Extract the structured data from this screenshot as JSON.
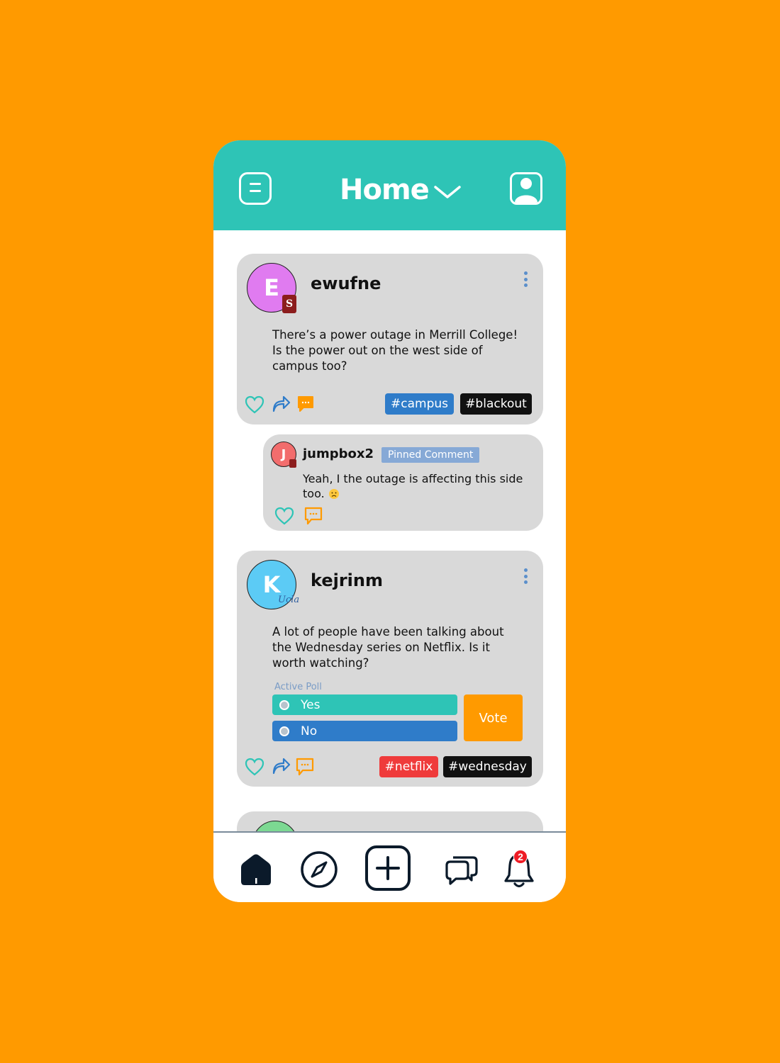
{
  "header": {
    "title": "Home",
    "menu_icon": "menu-icon",
    "profile_icon": "profile-icon",
    "chevron_icon": "chevron-down-icon"
  },
  "posts": [
    {
      "avatar_letter": "E",
      "avatar_color": "#E07BF0",
      "school_badge": "S",
      "username": "ewufne",
      "text_lines": [
        "There’s a power outage in Merrill College!",
        "Is the power out on the west side of",
        "campus too?"
      ],
      "tags": [
        "#campus",
        "#blackout"
      ]
    },
    {
      "avatar_letter": "K",
      "avatar_color": "#5CCBF5",
      "school_badge": "Ucla",
      "username": "kejrinm",
      "text_lines": [
        "A lot of people have been talking about",
        "the Wednesday series on Netflix. Is it",
        "worth watching?"
      ],
      "poll": {
        "label": "Active Poll",
        "options": [
          "Yes",
          "No"
        ],
        "vote_label": "Vote"
      },
      "tags": [
        "#netflix",
        "#wednesday"
      ]
    }
  ],
  "comment": {
    "avatar_letter": "J",
    "avatar_color": "#F26D6D",
    "username": "jumpbox2",
    "pinned_label": "Pinned Comment",
    "text_line1": "Yeah, I the outage is affecting this side",
    "text_line2": "too."
  },
  "nav": {
    "items": [
      "home-icon",
      "explore-icon",
      "create-post-icon",
      "messages-icon",
      "notifications-icon"
    ],
    "notification_count": "2"
  },
  "colors": {
    "background": "#FF9A00",
    "header": "#2EC4B6",
    "card": "#D9D9D9",
    "tag_blue": "#2F7CC9",
    "tag_red": "#EF3B3B",
    "poll_yes": "#2EC4B6",
    "poll_no": "#2F7CC9"
  }
}
